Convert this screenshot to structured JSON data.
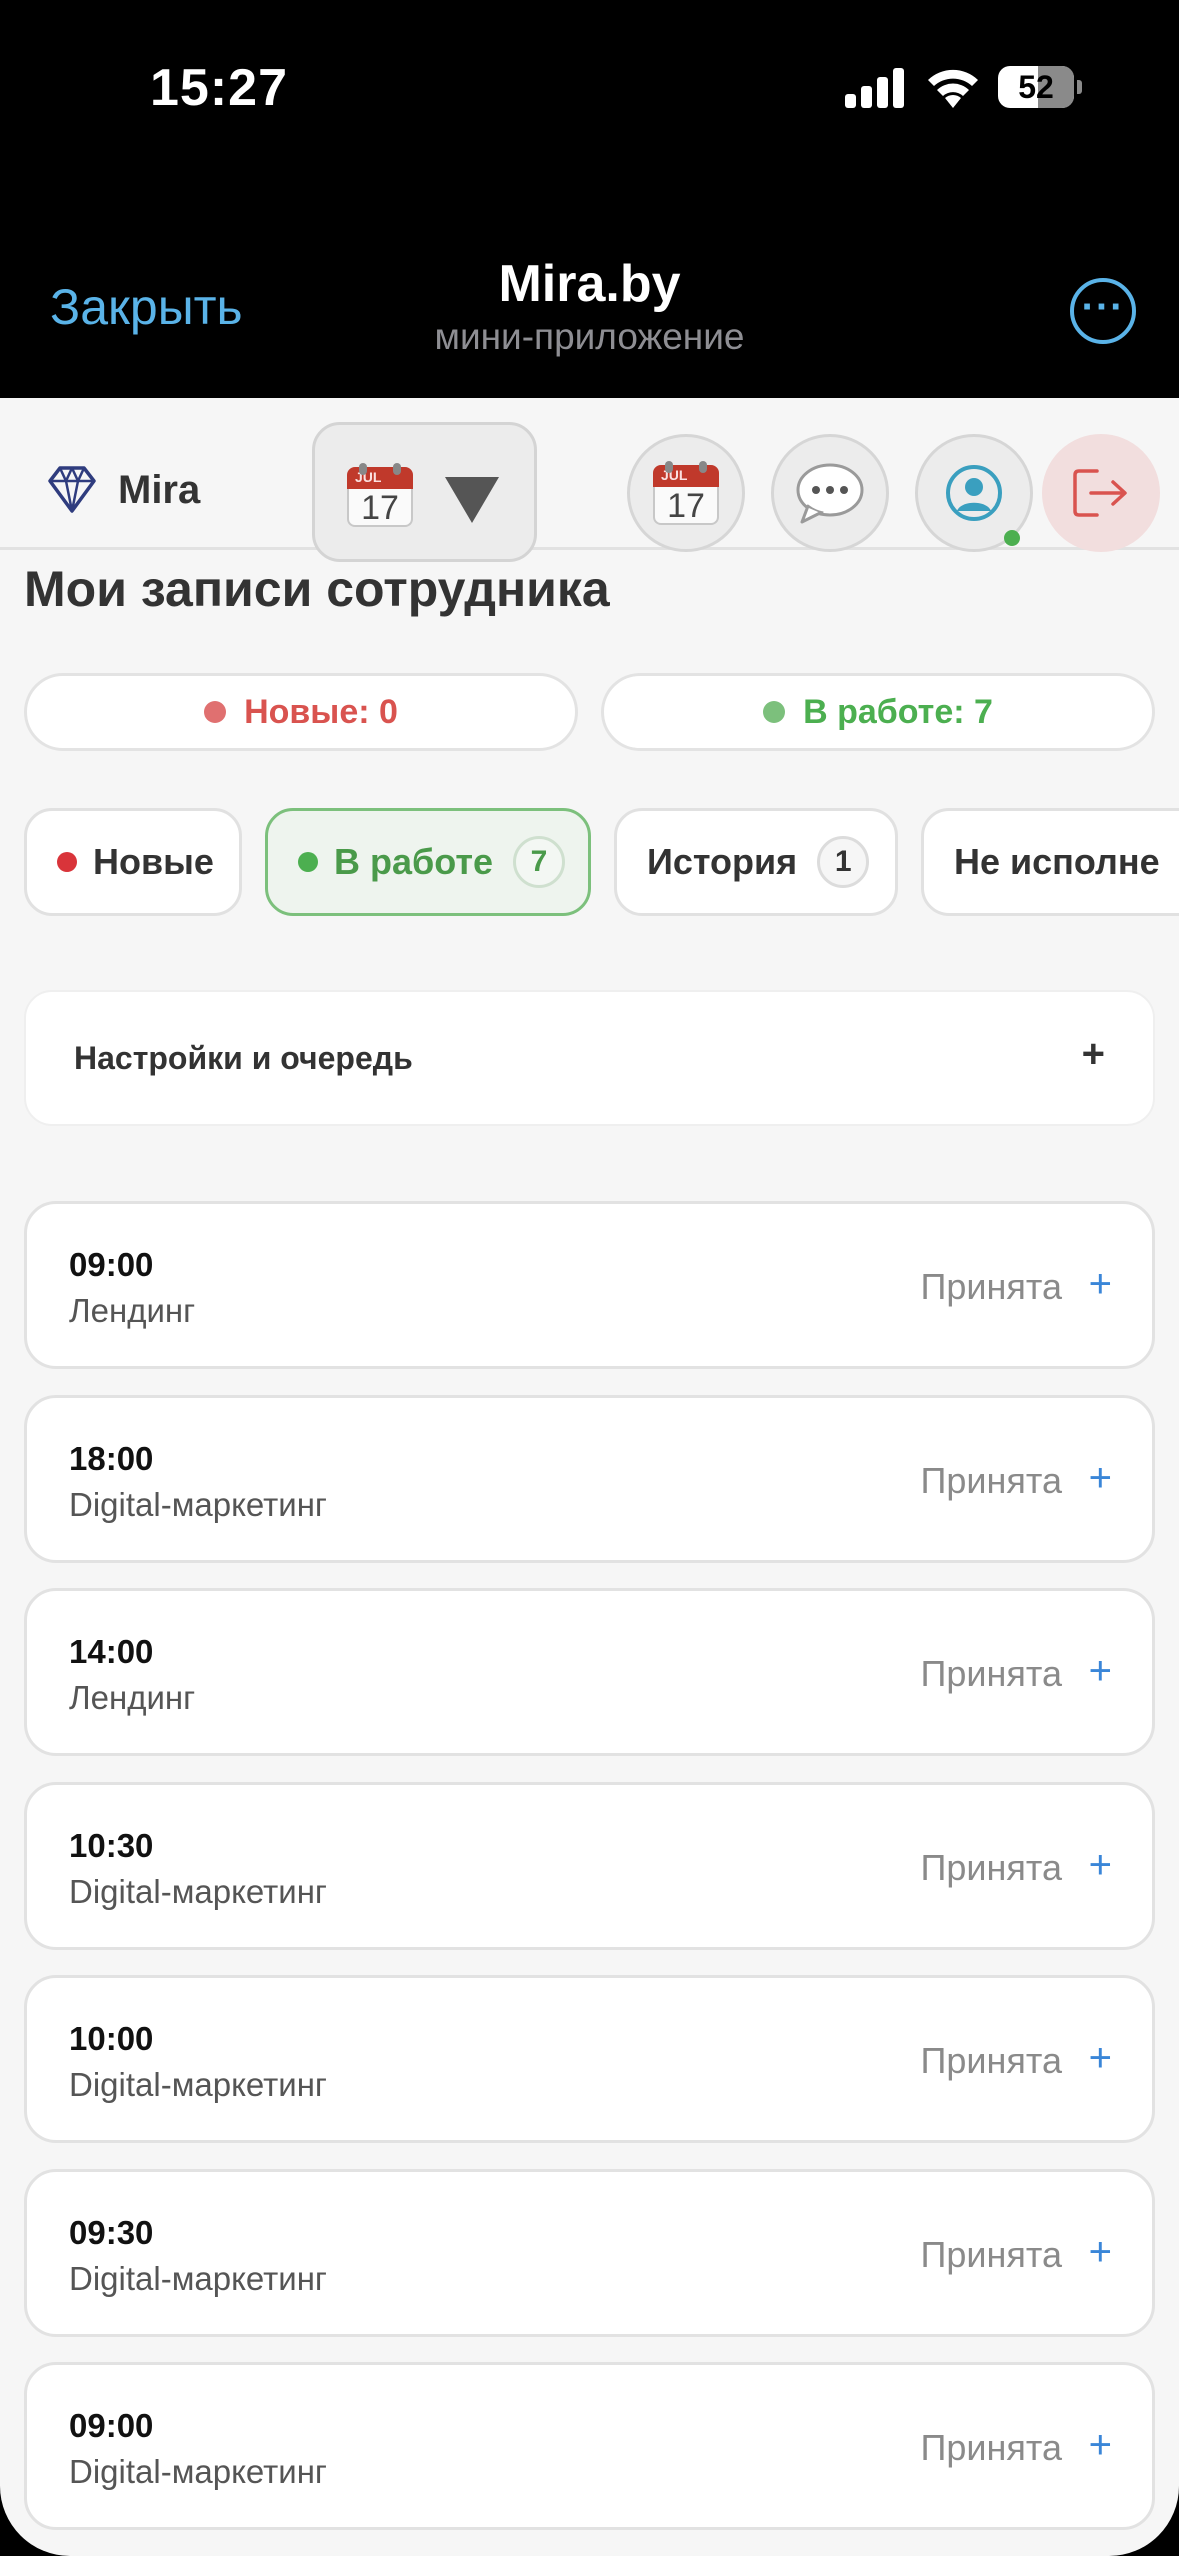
{
  "status_bar": {
    "time": "15:27",
    "battery": "52"
  },
  "header": {
    "close_label": "Закрыть",
    "title": "Mira.by",
    "subtitle": "мини-приложение",
    "more_glyph": "···"
  },
  "nav": {
    "brand": "Mira",
    "calendar_day": "17",
    "calendar_month": "JUL",
    "icons": [
      "calendar-icon",
      "chat-icon",
      "profile-icon",
      "logout-icon"
    ]
  },
  "page_title": "Мои записи сотрудника",
  "counters": {
    "new_label": "Новые: 0",
    "in_work_label": "В работе: 7",
    "new_color": "#d9534f",
    "in_work_color": "#4caf50"
  },
  "tabs": [
    {
      "label": "Новые",
      "badge": ""
    },
    {
      "label": "В работе",
      "badge": "7"
    },
    {
      "label": "История",
      "badge": "1"
    },
    {
      "label": "Не исполне",
      "badge": ""
    }
  ],
  "settings": {
    "label": "Настройки и очередь",
    "toggle": "+"
  },
  "appointments": [
    {
      "time": "09:00",
      "service": "Лендинг",
      "status": "Принята"
    },
    {
      "time": "18:00",
      "service": "Digital-маркетинг",
      "status": "Принята"
    },
    {
      "time": "14:00",
      "service": "Лендинг",
      "status": "Принята"
    },
    {
      "time": "10:30",
      "service": "Digital-маркетинг",
      "status": "Принята"
    },
    {
      "time": "10:00",
      "service": "Digital-маркетинг",
      "status": "Принята"
    },
    {
      "time": "09:30",
      "service": "Digital-маркетинг",
      "status": "Принята"
    },
    {
      "time": "09:00",
      "service": "Digital-маркетинг",
      "status": "Принята"
    }
  ],
  "expand_glyph": "+"
}
